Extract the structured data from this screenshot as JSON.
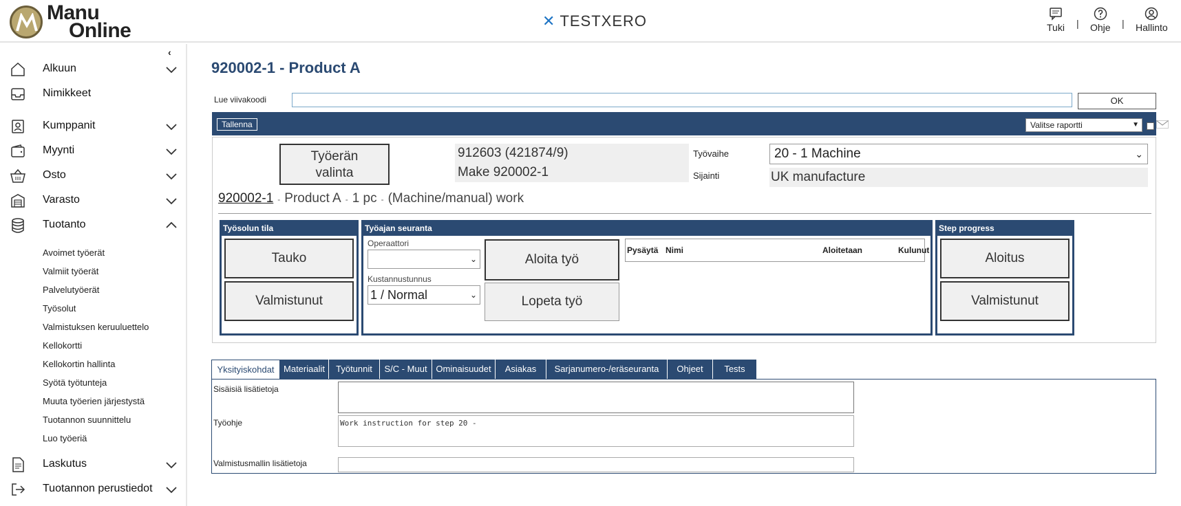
{
  "header": {
    "logo_line1": "Manu",
    "logo_line2": "Online",
    "company": "TESTXERO",
    "support": "Tuki",
    "help": "Ohje",
    "admin": "Hallinto",
    "separator": "|"
  },
  "sidebar": {
    "collapse_glyph": "‹",
    "items": [
      {
        "label": "Alkuun",
        "icon": "home-icon",
        "expandable": true
      },
      {
        "label": "Nimikkeet",
        "icon": "inbox-icon",
        "expandable": false
      },
      {
        "label": "Kumppanit",
        "icon": "contact-card-icon",
        "expandable": true
      },
      {
        "label": "Myynti",
        "icon": "wallet-icon",
        "expandable": true
      },
      {
        "label": "Osto",
        "icon": "basket-icon",
        "expandable": true
      },
      {
        "label": "Varasto",
        "icon": "warehouse-icon",
        "expandable": true
      },
      {
        "label": "Tuotanto",
        "icon": "database-icon",
        "expandable": true,
        "expanded": true
      },
      {
        "label": "Laskutus",
        "icon": "document-icon",
        "expandable": true
      },
      {
        "label": "Tuotannon perustiedot",
        "icon": "sign-in-icon",
        "expandable": true
      }
    ],
    "subitems": [
      "Avoimet työerät",
      "Valmiit työerät",
      "Palvelutyöerät",
      "Työsolut",
      "Valmistuksen keruuluettelo",
      "Kellokortti",
      "Kellokortin hallinta",
      "Syötä työtunteja",
      "Muuta työerien järjestystä",
      "Tuotannon suunnittelu",
      "Luo työeriä"
    ]
  },
  "main": {
    "title": "920002-1 - Product A",
    "barcode_label": "Lue viivakoodi",
    "barcode_value": "",
    "ok_label": "OK",
    "save_label": "Tallenna",
    "report_select": "Valitse raportti",
    "batch_button": "Työerän valinta",
    "batch_line1": "Työerän",
    "batch_line2": "valinta",
    "order_ref": "912603 (421874/9)",
    "make_ref": "Make 920002-1",
    "phase_label": "Työvaihe",
    "phase_value": "20 - 1 Machine",
    "location_label": "Sijainti",
    "location_value": "UK manufacture",
    "work_code": "920002-1",
    "work_product": "Product A",
    "work_qty": "1 pc",
    "work_type": "(Machine/manual) work",
    "work_sep": "-"
  },
  "cell_status": {
    "title": "Työsolun tila",
    "pause": "Tauko",
    "done": "Valmistunut"
  },
  "time_tracking": {
    "title": "Työajan seuranta",
    "operator_label": "Operaattori",
    "operator_value": "",
    "cost_label": "Kustannustunnus",
    "cost_value": "1 / Normal",
    "start_work": "Aloita työ",
    "stop_work": "Lopeta työ",
    "columns": [
      "Pysäytä",
      "Nimi",
      "Aloitetaan",
      "Kulunut"
    ]
  },
  "step_progress": {
    "title": "Step progress",
    "start": "Aloitus",
    "done": "Valmistunut"
  },
  "tabs": [
    {
      "label": "Yksityiskohdat",
      "active": true
    },
    {
      "label": "Materiaalit"
    },
    {
      "label": "Työtunnit"
    },
    {
      "label": "S/C - Muut"
    },
    {
      "label": "Ominaisuudet"
    },
    {
      "label": "Asiakas"
    },
    {
      "label": "Sarjanumero-/eräseuranta"
    },
    {
      "label": "Ohjeet"
    },
    {
      "label": "Tests"
    }
  ],
  "details": {
    "internal_label": "Sisäisiä lisätietoja",
    "internal_value": "",
    "instruction_label": "Työohje",
    "instruction_value": "Work instruction for step 20 -",
    "model_label": "Valmistusmallin lisätietoja",
    "model_value": ""
  },
  "colors": {
    "accent": "#2b4a72",
    "logo_gold": "#b9a770",
    "brand_blue": "#1e74c4"
  }
}
